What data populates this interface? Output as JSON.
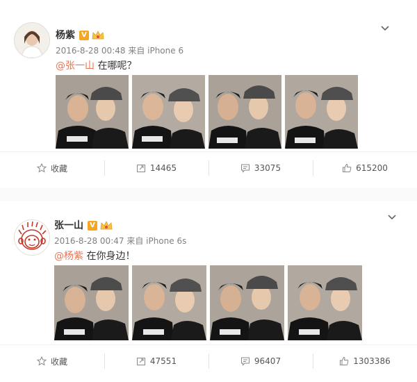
{
  "posts": [
    {
      "author": "杨紫",
      "verified_badge": "V",
      "meta": "2016-8-28 00:48 来自 iPhone 6",
      "mention": "@张一山",
      "text": " 在哪呢？",
      "actions": {
        "favorite_label": "收藏",
        "repost_count": "14465",
        "comment_count": "33075",
        "like_count": "615200"
      },
      "photo_count": 4
    },
    {
      "author": "张一山",
      "verified_badge": "V",
      "meta": "2016-8-28 00:47 来自 iPhone 6s",
      "mention": "@杨紫",
      "text": " 在你身边！",
      "actions": {
        "favorite_label": "收藏",
        "repost_count": "47551",
        "comment_count": "96407",
        "like_count": "1303386"
      },
      "photo_count": 4
    }
  ],
  "colors": {
    "mention": "#eb7350",
    "meta": "#808080",
    "badge": "#f5a623"
  },
  "icons": [
    "avatar",
    "verified-badge-icon",
    "vip-crown-icon",
    "chevron-down-icon",
    "star-icon",
    "repost-icon",
    "comment-icon",
    "like-icon"
  ]
}
